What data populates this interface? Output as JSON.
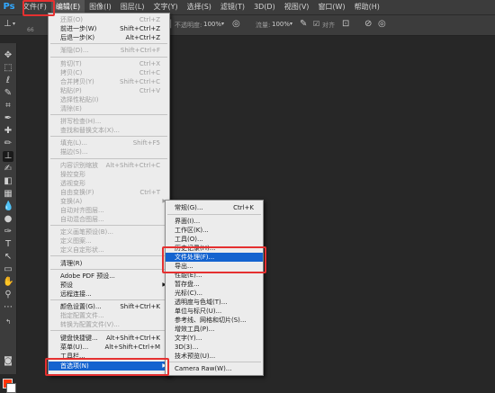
{
  "menubar": {
    "logo": "Ps",
    "items": [
      "文件(F)",
      "编辑(E)",
      "图像(I)",
      "图层(L)",
      "文字(Y)",
      "选择(S)",
      "滤镜(T)",
      "3D(D)",
      "视图(V)",
      "窗口(W)",
      "帮助(H)"
    ]
  },
  "options": {
    "opacity_label": "不透明度:",
    "opacity_value": "100%",
    "flow_label": "流量:",
    "flow_value": "100%",
    "align_label": "对齐",
    "size_value": "66"
  },
  "edit_menu": {
    "items": [
      {
        "label": "还原(O)",
        "shortcut": "Ctrl+Z",
        "disabled": true
      },
      {
        "label": "前进一步(W)",
        "shortcut": "Shift+Ctrl+Z",
        "disabled": false
      },
      {
        "label": "后退一步(K)",
        "shortcut": "Alt+Ctrl+Z",
        "disabled": false
      },
      {
        "label": "渐隐(D)...",
        "shortcut": "Shift+Ctrl+F",
        "disabled": true
      },
      {
        "label": "剪切(T)",
        "shortcut": "Ctrl+X",
        "disabled": true
      },
      {
        "label": "拷贝(C)",
        "shortcut": "Ctrl+C",
        "disabled": true
      },
      {
        "label": "合并拷贝(Y)",
        "shortcut": "Shift+Ctrl+C",
        "disabled": true
      },
      {
        "label": "粘贴(P)",
        "shortcut": "Ctrl+V",
        "disabled": true
      },
      {
        "label": "选择性粘贴(I)",
        "shortcut": "",
        "disabled": true
      },
      {
        "label": "清除(E)",
        "shortcut": "",
        "disabled": true
      },
      {
        "label": "拼写检查(H)...",
        "shortcut": "",
        "disabled": true
      },
      {
        "label": "查找和替换文本(X)...",
        "shortcut": "",
        "disabled": true
      },
      {
        "label": "填充(L)...",
        "shortcut": "Shift+F5",
        "disabled": true
      },
      {
        "label": "描边(S)...",
        "shortcut": "",
        "disabled": true
      },
      {
        "label": "内容识别缩放",
        "shortcut": "Alt+Shift+Ctrl+C",
        "disabled": true
      },
      {
        "label": "操控变形",
        "shortcut": "",
        "disabled": true
      },
      {
        "label": "透视变形",
        "shortcut": "",
        "disabled": true
      },
      {
        "label": "自由变换(F)",
        "shortcut": "Ctrl+T",
        "disabled": true
      },
      {
        "label": "变换(A)",
        "shortcut": "",
        "disabled": true
      },
      {
        "label": "自动对齐图层...",
        "shortcut": "",
        "disabled": true
      },
      {
        "label": "自动混合图层...",
        "shortcut": "",
        "disabled": true
      },
      {
        "label": "定义画笔预设(B)...",
        "shortcut": "",
        "disabled": true
      },
      {
        "label": "定义图案...",
        "shortcut": "",
        "disabled": true
      },
      {
        "label": "定义自定形状...",
        "shortcut": "",
        "disabled": true
      },
      {
        "label": "清理(R)",
        "shortcut": "",
        "disabled": false
      },
      {
        "label": "Adobe PDF 预设...",
        "shortcut": "",
        "disabled": false
      },
      {
        "label": "预设",
        "shortcut": "",
        "disabled": false
      },
      {
        "label": "远程连接...",
        "shortcut": "",
        "disabled": false
      },
      {
        "label": "颜色设置(G)...",
        "shortcut": "Shift+Ctrl+K",
        "disabled": false
      },
      {
        "label": "指定配置文件...",
        "shortcut": "",
        "disabled": true
      },
      {
        "label": "转换为配置文件(V)...",
        "shortcut": "",
        "disabled": true
      },
      {
        "label": "键盘快捷键...",
        "shortcut": "Alt+Shift+Ctrl+K",
        "disabled": false
      },
      {
        "label": "菜单(U)...",
        "shortcut": "Alt+Shift+Ctrl+M",
        "disabled": false
      },
      {
        "label": "工具栏...",
        "shortcut": "",
        "disabled": false
      },
      {
        "label": "首选项(N)",
        "shortcut": "",
        "disabled": false
      }
    ]
  },
  "prefs_menu": {
    "items": [
      {
        "label": "常规(G)...",
        "shortcut": "Ctrl+K"
      },
      {
        "label": "界面(I)...",
        "shortcut": ""
      },
      {
        "label": "工作区(K)...",
        "shortcut": ""
      },
      {
        "label": "工具(O)...",
        "shortcut": ""
      },
      {
        "label": "历史记录(H)...",
        "shortcut": ""
      },
      {
        "label": "文件处理(F)...",
        "shortcut": ""
      },
      {
        "label": "导出...",
        "shortcut": ""
      },
      {
        "label": "性能(E)...",
        "shortcut": ""
      },
      {
        "label": "暂存盘...",
        "shortcut": ""
      },
      {
        "label": "光标(C)...",
        "shortcut": ""
      },
      {
        "label": "透明度与色域(T)...",
        "shortcut": ""
      },
      {
        "label": "单位与标尺(U)...",
        "shortcut": ""
      },
      {
        "label": "参考线、网格和切片(S)...",
        "shortcut": ""
      },
      {
        "label": "增效工具(P)...",
        "shortcut": ""
      },
      {
        "label": "文字(Y)...",
        "shortcut": ""
      },
      {
        "label": "3D(3)...",
        "shortcut": ""
      },
      {
        "label": "技术预览(U)...",
        "shortcut": ""
      },
      {
        "label": "Camera Raw(W)...",
        "shortcut": ""
      }
    ]
  }
}
